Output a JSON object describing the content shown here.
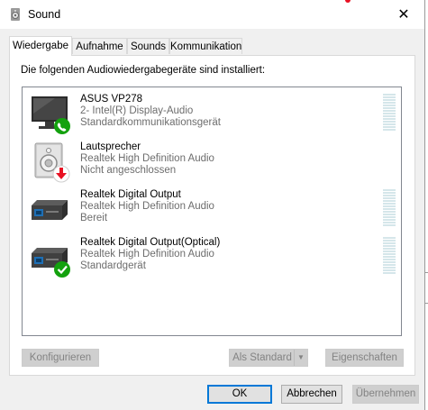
{
  "window": {
    "title": "Sound",
    "close_symbol": "✕"
  },
  "tabs": [
    {
      "label": "Wiedergabe",
      "active": true
    },
    {
      "label": "Aufnahme",
      "active": false
    },
    {
      "label": "Sounds",
      "active": false
    },
    {
      "label": "Kommunikation",
      "active": false
    }
  ],
  "panel": {
    "heading": "Die folgenden Audiowiedergabegeräte sind installiert:"
  },
  "devices": [
    {
      "name": "ASUS VP278",
      "line1": "2- Intel(R) Display-Audio",
      "line2": "Standardkommunikationsgerät",
      "icon": "monitor-icon",
      "badge": "phone-badge-icon"
    },
    {
      "name": "Lautsprecher",
      "line1": "Realtek High Definition Audio",
      "line2": "Nicht angeschlossen",
      "icon": "speaker-icon",
      "badge": "unplugged-badge-icon"
    },
    {
      "name": "Realtek Digital Output",
      "line1": "Realtek High Definition Audio",
      "line2": "Bereit",
      "icon": "digital-output-icon",
      "badge": ""
    },
    {
      "name": "Realtek Digital Output(Optical)",
      "line1": "Realtek High Definition Audio",
      "line2": "Standardgerät",
      "icon": "digital-output-icon",
      "badge": "check-badge-icon"
    }
  ],
  "buttons": {
    "configure": "Konfigurieren",
    "set_default": "Als Standard",
    "properties": "Eigenschaften",
    "ok": "OK",
    "cancel": "Abbrechen",
    "apply": "Übernehmen"
  },
  "colors": {
    "accent": "#0078d7",
    "check": "#13a10e",
    "unplugged": "#e81123"
  }
}
